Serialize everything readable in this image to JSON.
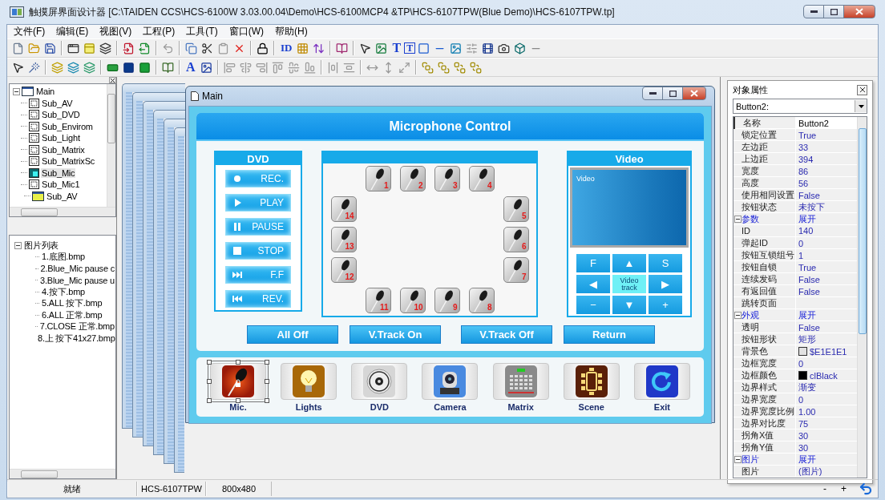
{
  "window": {
    "title": "触摸屏界面设计器 [C:\\TAIDEN CCS\\HCS-6100W 3.03.00.04\\Demo\\HCS-6100MCP4 &TP\\HCS-6107TPW(Blue Demo)\\HCS-6107TPW.tp]"
  },
  "menu": [
    "文件(F)",
    "编辑(E)",
    "视图(V)",
    "工程(P)",
    "工具(T)",
    "窗口(W)",
    "帮助(H)"
  ],
  "toolbar_glyphs": [
    "ID",
    "T",
    "T",
    "A"
  ],
  "page_tree": [
    {
      "label": "Main",
      "kind": "page",
      "expanded": true,
      "selected": false,
      "children": [
        {
          "label": "Sub_AV",
          "kind": "subpage",
          "selected": false
        },
        {
          "label": "Sub_DVD",
          "kind": "subpage",
          "selected": false
        },
        {
          "label": "Sub_Envirom",
          "kind": "subpage",
          "selected": false
        },
        {
          "label": "Sub_Light",
          "kind": "subpage",
          "selected": false
        },
        {
          "label": "Sub_Matrix",
          "kind": "subpage",
          "selected": false
        },
        {
          "label": "Sub_MatrixSc",
          "kind": "subpage",
          "selected": false
        },
        {
          "label": "Sub_Mic",
          "kind": "subpage",
          "selected": true
        },
        {
          "label": "Sub_Mic1",
          "kind": "subpage",
          "selected": false
        }
      ]
    },
    {
      "label": "Sub_AV",
      "kind": "popup",
      "selected": false
    }
  ],
  "image_list": {
    "label": "图片列表",
    "expanded": true,
    "selected": false,
    "children": [
      {
        "label": "1.底图.bmp",
        "selected": false
      },
      {
        "label": "2.Blue_Mic pause c",
        "selected": false
      },
      {
        "label": "3.Blue_Mic pause u",
        "selected": false
      },
      {
        "label": "4.按下.bmp",
        "selected": false
      },
      {
        "label": "5.ALL 按下.bmp",
        "selected": false
      },
      {
        "label": "6.ALL 正常.bmp",
        "selected": false
      },
      {
        "label": "7.CLOSE 正常.bmp",
        "selected": false
      },
      {
        "label": "8.上 按下41x27.bmp",
        "selected": false
      }
    ]
  },
  "main_window": {
    "title": "Main",
    "header": "Microphone Control",
    "dvd": {
      "title": "DVD",
      "buttons": [
        {
          "kind": "record",
          "label": "REC."
        },
        {
          "kind": "play",
          "label": "PLAY"
        },
        {
          "kind": "pause",
          "label": "PAUSE"
        },
        {
          "kind": "stop",
          "label": "STOP"
        },
        {
          "kind": "forward",
          "label": "F.F"
        },
        {
          "kind": "rewind",
          "label": "REV."
        }
      ]
    },
    "mics": [
      "1",
      "2",
      "3",
      "4",
      "14",
      "5",
      "13",
      "6",
      "12",
      "7",
      "11",
      "10",
      "9",
      "8"
    ],
    "video": {
      "title": "Video",
      "screen_label": "Video",
      "controls": [
        {
          "label": "F",
          "kind": "key"
        },
        {
          "label": "▲",
          "kind": "key"
        },
        {
          "label": "S",
          "kind": "key"
        },
        {
          "label": "◀",
          "kind": "key"
        },
        {
          "label": "Video track",
          "kind": "toggle"
        },
        {
          "label": "▶",
          "kind": "key"
        },
        {
          "label": "−",
          "kind": "key"
        },
        {
          "label": "▼",
          "kind": "key"
        },
        {
          "label": "+",
          "kind": "key"
        }
      ]
    },
    "actions": [
      "All Off",
      "V.Track On",
      "V.Track Off",
      "Return"
    ],
    "nav": [
      {
        "kind": "mic",
        "label": "Mic.",
        "selected": true
      },
      {
        "kind": "lights",
        "label": "Lights",
        "selected": false
      },
      {
        "kind": "dvd",
        "label": "DVD",
        "selected": false
      },
      {
        "kind": "camera",
        "label": "Camera",
        "selected": false
      },
      {
        "kind": "matrix",
        "label": "Matrix",
        "selected": false
      },
      {
        "kind": "scene",
        "label": "Scene",
        "selected": false
      },
      {
        "kind": "exit",
        "label": "Exit",
        "selected": false
      }
    ]
  },
  "properties": {
    "title": "对象属性",
    "object": "Button2:",
    "rows": [
      {
        "kind": "prop",
        "name": "名称",
        "value": "Button2",
        "selected": true
      },
      {
        "kind": "prop",
        "name": "锁定位置",
        "value": "True",
        "selected": false
      },
      {
        "kind": "prop",
        "name": "左边距",
        "value": "33",
        "selected": false
      },
      {
        "kind": "prop",
        "name": "上边距",
        "value": "394",
        "selected": false
      },
      {
        "kind": "prop",
        "name": "宽度",
        "value": "86",
        "selected": false
      },
      {
        "kind": "prop",
        "name": "高度",
        "value": "56",
        "selected": false
      },
      {
        "kind": "prop",
        "name": "使用相同设置",
        "value": "False",
        "selected": false
      },
      {
        "kind": "prop",
        "name": "按钮状态",
        "value": "未按下",
        "selected": false
      },
      {
        "kind": "section",
        "name": "参数",
        "value": "展开",
        "expanded": true,
        "selected": false
      },
      {
        "kind": "prop",
        "name": "ID",
        "value": "140",
        "selected": false
      },
      {
        "kind": "prop",
        "name": "弹起ID",
        "value": "0",
        "selected": false
      },
      {
        "kind": "prop",
        "name": "按钮互锁组号",
        "value": "1",
        "selected": false
      },
      {
        "kind": "prop",
        "name": "按钮自锁",
        "value": "True",
        "selected": false
      },
      {
        "kind": "prop",
        "name": "连续发码",
        "value": "False",
        "selected": false
      },
      {
        "kind": "prop",
        "name": "有返回值",
        "value": "False",
        "selected": false
      },
      {
        "kind": "prop",
        "name": "跳转页面",
        "selected": false
      },
      {
        "kind": "section",
        "name": "外观",
        "value": "展开",
        "expanded": true,
        "selected": false
      },
      {
        "kind": "prop",
        "name": "透明",
        "value": "False",
        "selected": false
      },
      {
        "kind": "prop",
        "name": "按钮形状",
        "value": "矩形",
        "selected": false
      },
      {
        "kind": "prop",
        "name": "背景色",
        "value": "$E1E1E1",
        "color": "#e1e1e1",
        "selected": false
      },
      {
        "kind": "prop",
        "name": "边框宽度",
        "value": "0",
        "selected": false
      },
      {
        "kind": "prop",
        "name": "边框颜色",
        "value": "clBlack",
        "color": "#000000",
        "selected": false
      },
      {
        "kind": "prop",
        "name": "边界样式",
        "value": "渐变",
        "selected": false
      },
      {
        "kind": "prop",
        "name": "边界宽度",
        "value": "0",
        "selected": false
      },
      {
        "kind": "prop",
        "name": "边界宽度比例",
        "value": "1.00",
        "selected": false
      },
      {
        "kind": "prop",
        "name": "边界对比度",
        "value": "75",
        "selected": false
      },
      {
        "kind": "prop",
        "name": "拐角X值",
        "value": "30",
        "selected": false
      },
      {
        "kind": "prop",
        "name": "拐角Y值",
        "value": "30",
        "selected": false
      },
      {
        "kind": "section",
        "name": "图片",
        "value": "展开",
        "expanded": true,
        "selected": false
      },
      {
        "kind": "prop",
        "name": "图片",
        "value": "(图片)",
        "selected": false
      }
    ]
  },
  "status_bar": [
    "就绪",
    "HCS-6107TPW",
    "800x480"
  ],
  "zoom": [
    "-",
    "+"
  ]
}
